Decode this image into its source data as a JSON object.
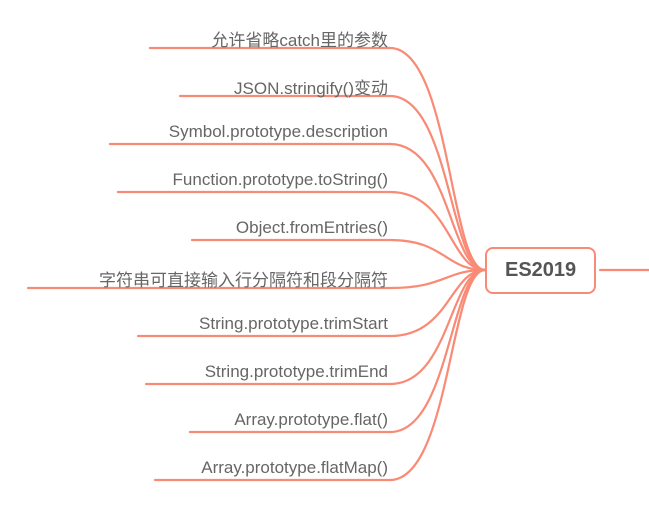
{
  "colors": {
    "connector": "#f98a76",
    "text": "#666666",
    "rootText": "#555555"
  },
  "root": {
    "label": "ES2019"
  },
  "leaves": [
    {
      "label": "允许省略catch里的参数"
    },
    {
      "label": "JSON.stringify()变动"
    },
    {
      "label": "Symbol.prototype.description"
    },
    {
      "label": "Function.prototype.toString()"
    },
    {
      "label": "Object.fromEntries()"
    },
    {
      "label": "字符串可直接输入行分隔符和段分隔符"
    },
    {
      "label": "String.prototype.trimStart"
    },
    {
      "label": "String.prototype.trimEnd"
    },
    {
      "label": "Array.prototype.flat()"
    },
    {
      "label": "Array.prototype.flatMap()"
    }
  ],
  "chart_data": {
    "type": "mindmap",
    "root": "ES2019",
    "children": [
      "允许省略catch里的参数",
      "JSON.stringify()变动",
      "Symbol.prototype.description",
      "Function.prototype.toString()",
      "Object.fromEntries()",
      "字符串可直接输入行分隔符和段分隔符",
      "String.prototype.trimStart",
      "String.prototype.trimEnd",
      "Array.prototype.flat()",
      "Array.prototype.flatMap()"
    ]
  }
}
